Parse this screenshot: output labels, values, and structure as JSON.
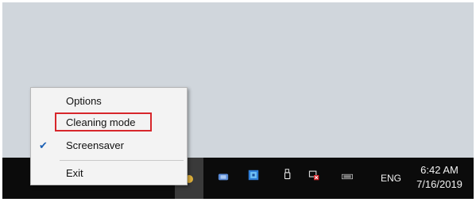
{
  "context_menu": {
    "items": [
      {
        "label": "Options",
        "checked": false
      },
      {
        "label": "Cleaning mode",
        "checked": false,
        "highlighted": true
      },
      {
        "label": "Screensaver",
        "checked": true
      },
      {
        "label": "Exit",
        "checked": false
      }
    ],
    "check_glyph": "✔"
  },
  "taskbar": {
    "language": "ENG",
    "time": "6:42 AM",
    "date": "7/16/2019",
    "tray_icons": [
      "app-tray-icon",
      "network-tray-icon",
      "blue-app-tray-icon",
      "usb-drive-tray-icon",
      "network-disconnected-tray-icon",
      "keyboard-tray-icon"
    ]
  },
  "colors": {
    "desktop": "#d0d6dc",
    "taskbar": "#0b0b0b",
    "highlight_border": "#d7262b"
  }
}
